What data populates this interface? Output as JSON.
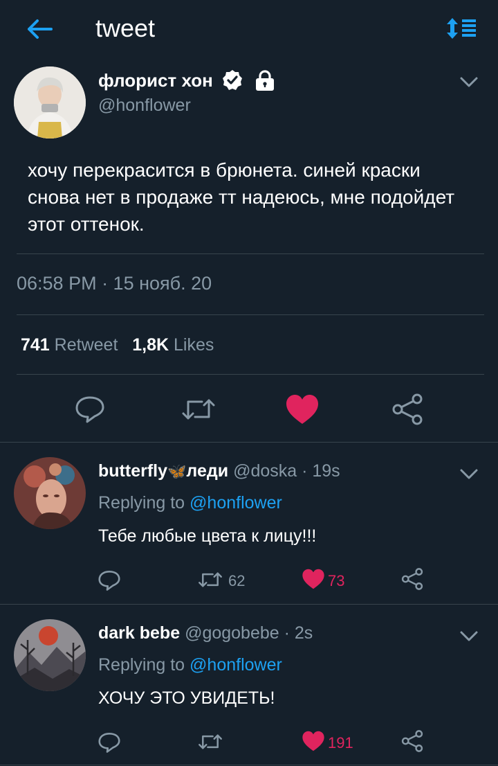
{
  "header": {
    "title": "tweet",
    "back_icon": "arrow-left-icon",
    "sort_icon": "sort-icon"
  },
  "colors": {
    "background": "#15202b",
    "accent": "#1da1f2",
    "like": "#e0245e",
    "muted": "#8899a6",
    "divider": "#38444d"
  },
  "tweet": {
    "display_name": "флорист хон",
    "handle": "@honflower",
    "text": "хочу перекрасится в брюнета. синей краски снова нет в продаже тт надеюсь, мне подойдет этот оттенок.",
    "timestamp": "06:58 PM · 15 нояб. 20",
    "retweet_count": "741",
    "retweet_label": "Retweet",
    "like_count": "1,8K",
    "like_label": "Likes",
    "liked": true
  },
  "replies": [
    {
      "display_name": "butterfly",
      "emoji": "🦋",
      "display_name_suffix": "леди",
      "meta": "@doska · 19s",
      "replying_prefix": "Replying to",
      "replying_to": "@honflower",
      "text": "Тебе любые цвета к лицу!!!",
      "retweets": "62",
      "likes": "73"
    },
    {
      "display_name": "dark bebe",
      "meta": "@gogobebe · 2s",
      "replying_prefix": "Replying to",
      "replying_to": "@honflower",
      "text": "ХОЧУ ЭТО УВИДЕТЬ!",
      "retweets": "",
      "likes": "191"
    }
  ]
}
